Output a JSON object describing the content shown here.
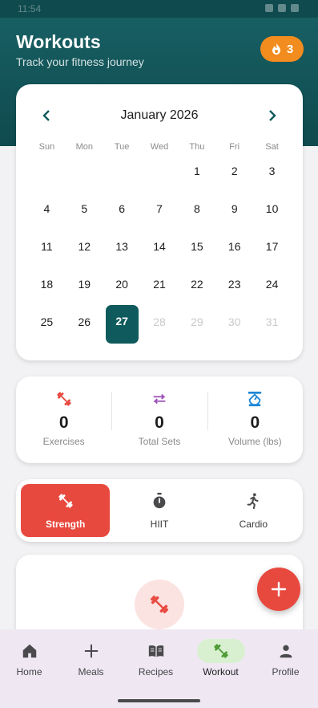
{
  "status_bar": {
    "time": "11:54"
  },
  "header": {
    "title": "Workouts",
    "subtitle": "Track your fitness journey",
    "streak_count": "3",
    "streak_color": "#f28c1e"
  },
  "calendar": {
    "month_label": "January 2026",
    "weekdays": [
      "Sun",
      "Mon",
      "Tue",
      "Wed",
      "Thu",
      "Fri",
      "Sat"
    ],
    "leading_blanks": 4,
    "days": [
      "1",
      "2",
      "3",
      "4",
      "5",
      "6",
      "7",
      "8",
      "9",
      "10",
      "11",
      "12",
      "13",
      "14",
      "15",
      "16",
      "17",
      "18",
      "19",
      "20",
      "21",
      "22",
      "23",
      "24",
      "25",
      "26",
      "27",
      "28",
      "29",
      "30",
      "31"
    ],
    "selected_day": "27",
    "accent_color": "#0f5a5c"
  },
  "stats": [
    {
      "icon": "dumbbell-icon",
      "value": "0",
      "label": "Exercises",
      "color": "#e8493f"
    },
    {
      "icon": "repeat-icon",
      "value": "0",
      "label": "Total Sets",
      "color": "#9b4fb8"
    },
    {
      "icon": "scale-icon",
      "value": "0",
      "label": "Volume (lbs)",
      "color": "#1e88d8"
    }
  ],
  "workout_tabs": [
    {
      "icon": "dumbbell-icon",
      "label": "Strength",
      "active": true
    },
    {
      "icon": "stopwatch-icon",
      "label": "HIIT",
      "active": false
    },
    {
      "icon": "running-icon",
      "label": "Cardio",
      "active": false
    }
  ],
  "fab": {
    "icon": "plus-icon",
    "color": "#e8493f"
  },
  "bottom_nav": [
    {
      "icon": "home-icon",
      "label": "Home",
      "active": false
    },
    {
      "icon": "plus-icon",
      "label": "Meals",
      "active": false
    },
    {
      "icon": "book-icon",
      "label": "Recipes",
      "active": false
    },
    {
      "icon": "dumbbell-icon",
      "label": "Workout",
      "active": true
    },
    {
      "icon": "person-icon",
      "label": "Profile",
      "active": false
    }
  ]
}
